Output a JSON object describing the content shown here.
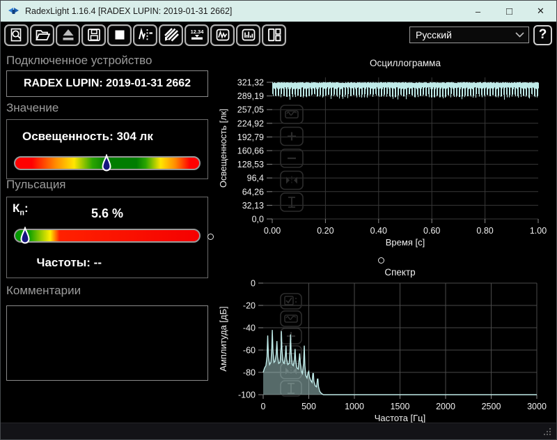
{
  "window": {
    "title": "RadexLight 1.16.4 [RADEX LUPIN: 2019-01-31 2662]",
    "controls": {
      "minimize": "–",
      "maximize": "□",
      "close": "✕"
    }
  },
  "toolbar": {
    "button_icons": [
      "device-search-icon",
      "open-file-icon",
      "eject-device-icon",
      "save-icon",
      "stop-icon",
      "measurement-cursor-icon",
      "pulsation-hatch-icon",
      "digital-display-icon",
      "oscillogram-view-icon",
      "spectrum-view-icon",
      "layout-panels-icon"
    ],
    "digital_label": "12.34",
    "language_select": {
      "value": "Русский"
    },
    "help_label": "?"
  },
  "left_panel": {
    "device_section": {
      "label": "Подключенное устройство",
      "device_name": "RADEX LUPIN: 2019-01-31 2662"
    },
    "value_section": {
      "label": "Значение",
      "reading": "Освещенность: 304 лк",
      "marker_position_pct": 49
    },
    "pulsation_section": {
      "label": "Пульсация",
      "kp_k": "К",
      "kp_sub": "п",
      "kp_colon": ":",
      "kp_value": "5.6 %",
      "marker_position_pct": 4.4,
      "frequencies": "Частоты: --"
    },
    "comments_section": {
      "label": "Комментарии",
      "text": ""
    }
  },
  "chart_buttons": [
    "autoscale-checkbox",
    "zoom-region",
    "zoom-in",
    "zoom-out",
    "fit-horizontal",
    "fit-vertical"
  ],
  "chart_data": [
    {
      "id": "oscillogram",
      "type": "line",
      "title": "Осциллограмма",
      "xlabel": "Время [с]",
      "ylabel": "Освещенность [лк]",
      "xlim": [
        0,
        1
      ],
      "ylim": [
        0,
        333
      ],
      "x_tick_values": [
        0,
        0.2,
        0.4,
        0.6,
        0.8,
        1.0
      ],
      "x_tick_labels": [
        "0.00",
        "0.20",
        "0.40",
        "0.60",
        "0.80",
        "1.00"
      ],
      "y_tick_values": [
        321.32,
        289.19,
        257.05,
        224.92,
        192.79,
        160.66,
        128.53,
        96.4,
        64.26,
        32.13,
        0
      ],
      "y_tick_labels": [
        "321,32",
        "289,19",
        "257,05",
        "224,92",
        "192,79",
        "160,66",
        "128,53",
        "96,4",
        "64,26",
        "32,13",
        "0,0"
      ],
      "grid": true,
      "legend": "none",
      "line_color": "#bfeae8",
      "signal": {
        "description": "dense 100 Hz rectified ripple of illuminance over 1 s",
        "top_lx": 322,
        "comb_top_lx": 305,
        "comb_bottom_lx": 285,
        "cycles_per_second": 100
      },
      "overlay_buttons": [
        "zoom-region",
        "zoom-in",
        "zoom-out",
        "fit-horizontal",
        "fit-vertical"
      ]
    },
    {
      "id": "spectrum",
      "type": "area",
      "title": "Спектр",
      "xlabel": "Частота [Гц]",
      "ylabel": "Амплитуда [дБ]",
      "xlim": [
        0,
        3000
      ],
      "ylim": [
        -100,
        0
      ],
      "x_tick_values": [
        0,
        500,
        1000,
        1500,
        2000,
        2500,
        3000
      ],
      "x_tick_labels": [
        "0",
        "500",
        "1000",
        "1500",
        "2000",
        "2500",
        "3000"
      ],
      "y_tick_values": [
        0,
        -20,
        -40,
        -60,
        -80,
        -100
      ],
      "y_tick_labels": [
        "0",
        "-20",
        "-40",
        "-60",
        "-80",
        "-100"
      ],
      "grid": true,
      "legend": "none",
      "line_color": "#bfeae8",
      "fill_color": "rgba(191,234,232,0.45)",
      "points": {
        "freq": [
          0,
          15,
          30,
          42,
          50,
          58,
          70,
          85,
          95,
          100,
          107,
          118,
          130,
          142,
          150,
          158,
          170,
          185,
          196,
          200,
          206,
          218,
          230,
          243,
          250,
          257,
          270,
          285,
          295,
          300,
          307,
          318,
          330,
          343,
          350,
          357,
          370,
          385,
          395,
          400,
          406,
          418,
          430,
          443,
          450,
          457,
          468,
          480,
          492,
          500,
          507,
          520,
          535,
          545,
          550,
          556,
          570,
          585,
          595,
          600,
          607,
          620,
          640,
          660,
          700,
          3000
        ],
        "db": [
          -80,
          -76,
          -74,
          -66,
          -47,
          -66,
          -73,
          -71,
          -58,
          -42,
          -60,
          -71,
          -70,
          -64,
          -52,
          -66,
          -72,
          -71,
          -58,
          -43,
          -60,
          -71,
          -72,
          -65,
          -56,
          -68,
          -73,
          -72,
          -60,
          -46,
          -62,
          -73,
          -74,
          -68,
          -59,
          -70,
          -76,
          -77,
          -68,
          -63,
          -70,
          -79,
          -81,
          -72,
          -56,
          -74,
          -83,
          -85,
          -80,
          -79,
          -84,
          -87,
          -89,
          -81,
          -81,
          -88,
          -92,
          -93,
          -86,
          -86,
          -93,
          -97,
          -99,
          -100,
          -100,
          -100
        ]
      },
      "overlay_buttons": [
        "autoscale-checkbox",
        "zoom-region",
        "zoom-in",
        "zoom-out",
        "fit-horizontal",
        "fit-vertical"
      ]
    }
  ]
}
